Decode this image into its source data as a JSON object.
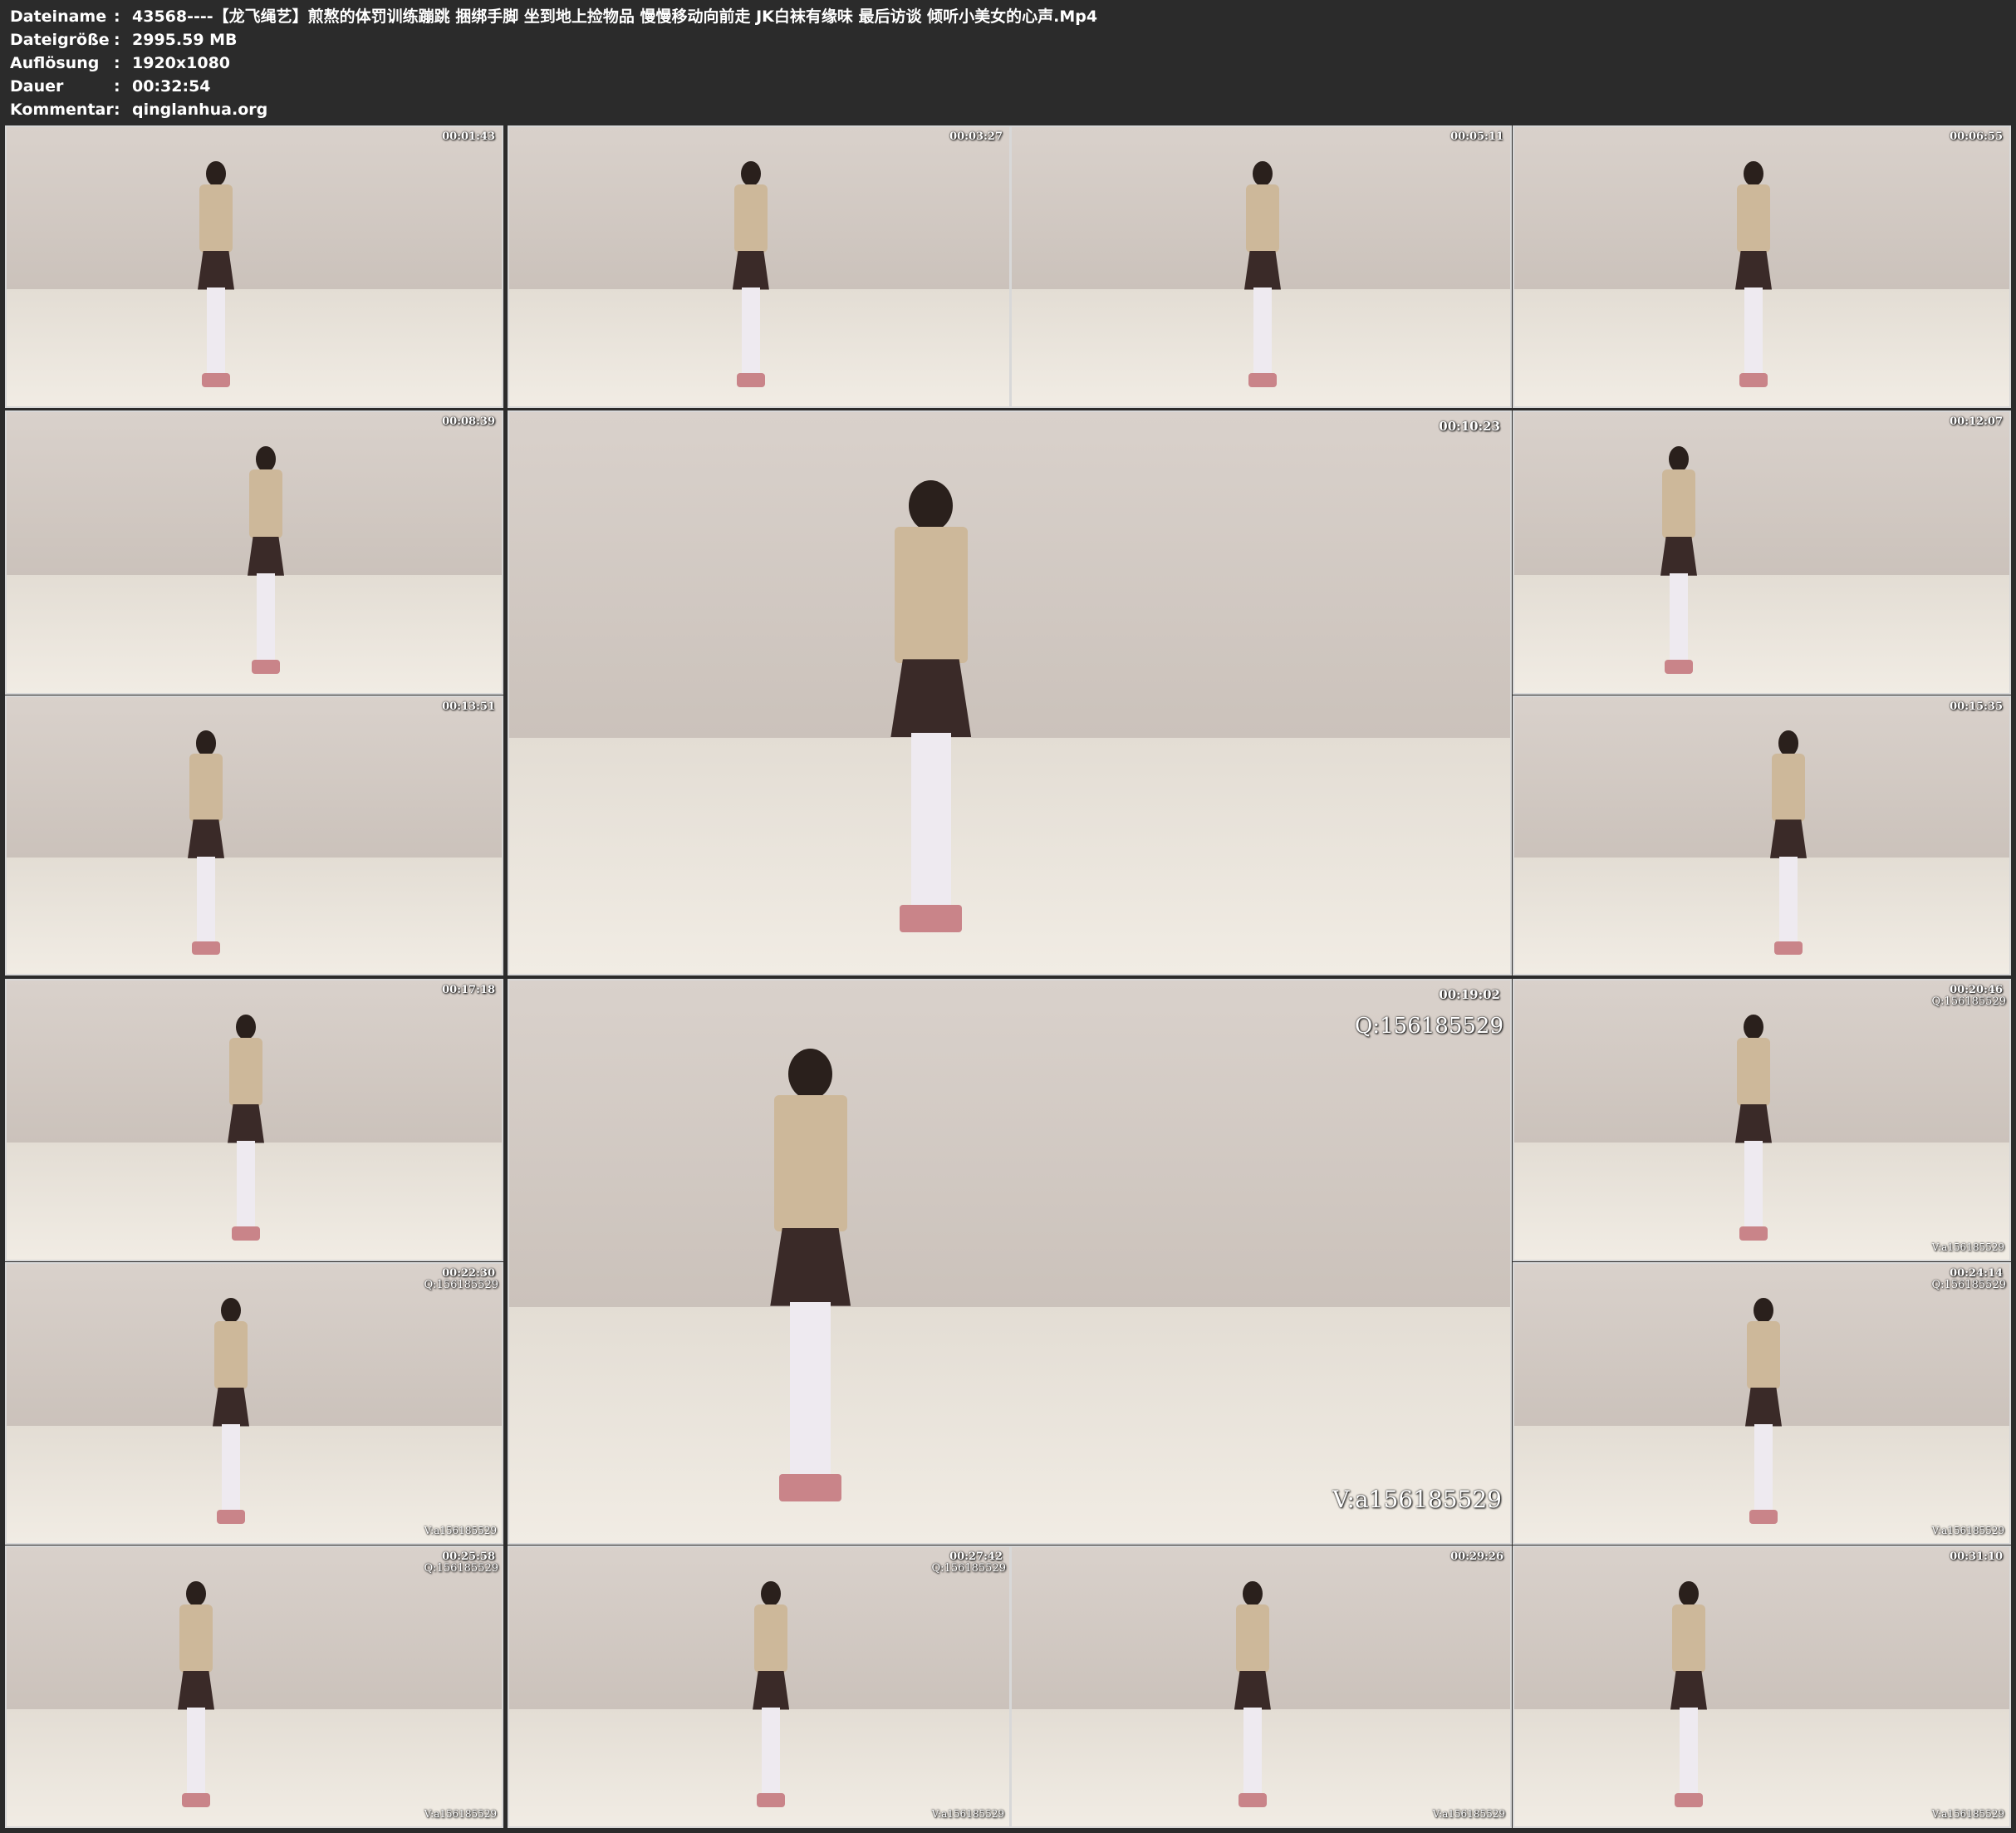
{
  "header": {
    "rows": [
      {
        "label": "Dateiname",
        "value": "43568----【龙飞绳艺】煎熬的体罚训练蹦跳 捆绑手脚 坐到地上捡物品 慢慢移动向前走 JK白袜有缘味 最后访谈 倾听小美女的心声.Mp4"
      },
      {
        "label": "Dateigröße",
        "value": "2995.59 MB"
      },
      {
        "label": "Auflösung",
        "value": "1920x1080"
      },
      {
        "label": "Dauer",
        "value": "00:32:54"
      },
      {
        "label": "Kommentar",
        "value": "qinglanhua.org"
      }
    ],
    "separator": ":"
  },
  "thumbnails": [
    {
      "timestamp": "00:01:43"
    },
    {
      "timestamp": "00:03:27"
    },
    {
      "timestamp": "00:05:11"
    },
    {
      "timestamp": "00:06:55"
    },
    {
      "timestamp": "00:08:39"
    },
    {
      "timestamp": "00:10:23"
    },
    {
      "timestamp": "00:12:07"
    },
    {
      "timestamp": "00:13:51"
    },
    {
      "timestamp": "00:15:35"
    },
    {
      "timestamp": "00:17:18"
    },
    {
      "timestamp": "00:19:02",
      "wm_top": "Q:156185529",
      "wm_bottom": "V:a156185529"
    },
    {
      "timestamp": "00:20:46",
      "wm_top": "Q:156185529",
      "wm_bottom": "V:a156185529"
    },
    {
      "timestamp": "00:22:30",
      "wm_top": "Q:156185529",
      "wm_bottom": "V:a156185529"
    },
    {
      "timestamp": "00:24:14",
      "wm_top": "Q:156185529",
      "wm_bottom": "V:a156185529"
    },
    {
      "timestamp": "00:25:58",
      "wm_top": "Q:156185529",
      "wm_bottom": "V:a156185529"
    },
    {
      "timestamp": "00:27:42",
      "wm_top": "Q:156185529",
      "wm_bottom": "V:a156185529"
    },
    {
      "timestamp": "00:29:26",
      "wm_top": "",
      "wm_bottom": "V:a156185529"
    },
    {
      "timestamp": "00:31:10",
      "wm_top": "",
      "wm_bottom": "V:a156185529"
    }
  ],
  "colors": {
    "background": "#2b2b2b",
    "text": "#ffffff",
    "frame_border": "#d8d8d8"
  }
}
